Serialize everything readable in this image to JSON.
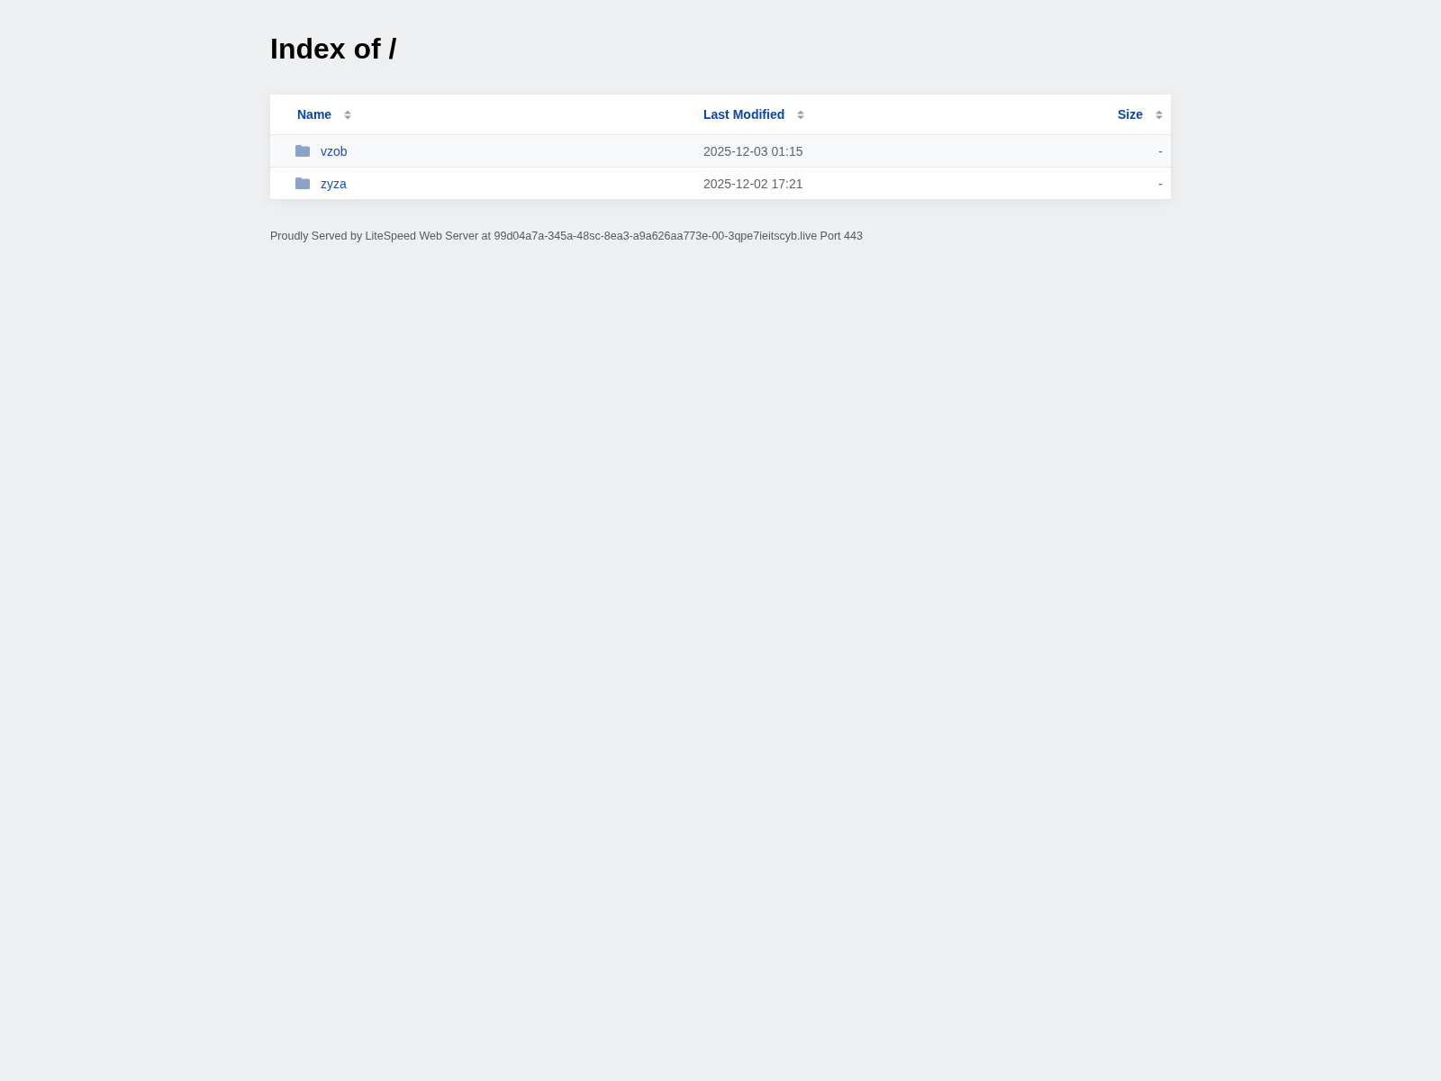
{
  "page": {
    "title": "Index of /"
  },
  "table": {
    "columns": [
      {
        "label": "Name"
      },
      {
        "label": "Last Modified"
      },
      {
        "label": "Size"
      }
    ],
    "rows": [
      {
        "name": "vzob",
        "last_modified": "2025-12-03 01:15",
        "size": "-"
      },
      {
        "name": "zyza",
        "last_modified": "2025-12-02 17:21",
        "size": "-"
      }
    ]
  },
  "footer": {
    "text": "Proudly Served by LiteSpeed Web Server at 99d04a7a-345a-48sc-8ea3-a9a626aa773e-00-3qpe7ieitscyb.live Port 443"
  }
}
